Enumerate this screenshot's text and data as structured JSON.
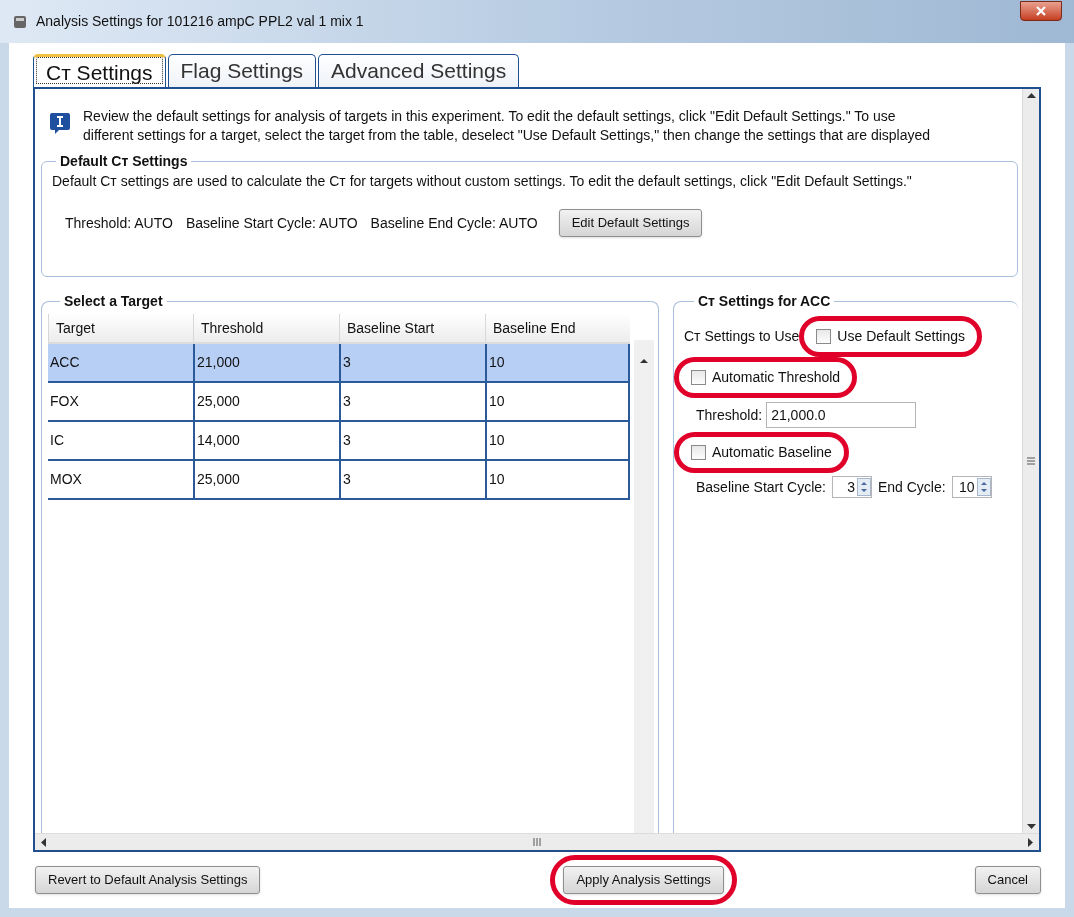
{
  "window": {
    "title": "Analysis Settings for 101216 ampC PPL2 val 1 mix 1"
  },
  "tabs": [
    {
      "label": "Cᴛ Settings",
      "selected": true
    },
    {
      "label": "Flag Settings",
      "selected": false
    },
    {
      "label": "Advanced Settings",
      "selected": false
    }
  ],
  "info": {
    "lines": [
      "Review the default settings for analysis of targets in this experiment. To edit the default settings, click \"Edit Default Settings.\" To use",
      "different settings for a target, select the target from the table, deselect \"Use Default Settings,\" then change the settings that are displayed"
    ]
  },
  "default_settings": {
    "title": "Default Cᴛ Settings",
    "description": "Default Cᴛ settings are used to calculate the Cᴛ for targets without custom settings. To edit the default settings, click \"Edit Default Settings.\"",
    "values": [
      "Threshold: AUTO",
      "Baseline Start Cycle: AUTO",
      "Baseline End Cycle: AUTO"
    ],
    "edit_button": "Edit Default Settings"
  },
  "target_table": {
    "title": "Select a Target",
    "columns": [
      "Target",
      "Threshold",
      "Baseline Start",
      "Baseline End"
    ],
    "rows": [
      {
        "cells": [
          "ACC",
          "21,000",
          "3",
          "10"
        ],
        "selected": true
      },
      {
        "cells": [
          "FOX",
          "25,000",
          "3",
          "10"
        ],
        "selected": false
      },
      {
        "cells": [
          "IC",
          "14,000",
          "3",
          "10"
        ],
        "selected": false
      },
      {
        "cells": [
          "MOX",
          "25,000",
          "3",
          "10"
        ],
        "selected": false
      }
    ]
  },
  "target_settings": {
    "title": "Cᴛ Settings for ACC",
    "use_label": "Cᴛ Settings to Use",
    "use_default": {
      "label": "Use Default Settings",
      "checked": false,
      "highlighted": true
    },
    "automatic_threshold": {
      "label": "Automatic Threshold",
      "checked": false,
      "highlighted": true
    },
    "threshold": {
      "label": "Threshold:",
      "value": "21,000.0"
    },
    "automatic_baseline": {
      "label": "Automatic Baseline",
      "checked": false,
      "highlighted": true
    },
    "baseline_start": {
      "label": "Baseline Start Cycle:",
      "value": "3"
    },
    "baseline_end": {
      "label": "End Cycle:",
      "value": "10"
    }
  },
  "buttons": [
    {
      "label": "Revert to Default Analysis Settings",
      "highlighted": false
    },
    {
      "label": "Apply Analysis Settings",
      "highlighted": true
    },
    {
      "label": "Cancel",
      "highlighted": false
    }
  ]
}
